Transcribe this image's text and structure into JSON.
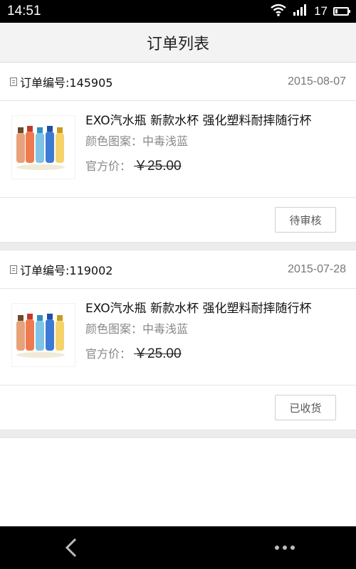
{
  "status_bar": {
    "time": "14:51",
    "battery_level": "17",
    "battery_fraction": 0.17,
    "icons": [
      "wifi-icon",
      "signal-icon",
      "battery-icon"
    ]
  },
  "header": {
    "title": "订单列表"
  },
  "orders": [
    {
      "order_label": "订单编号:145905",
      "date": "2015-08-07",
      "product_name": "EXO汽水瓶 新款水杯 强化塑料耐摔随行杯",
      "spec": "颜色图案：中毒浅蓝",
      "price_label": "官方价：",
      "price": "￥25.00",
      "status": "待审核"
    },
    {
      "order_label": "订单编号:119002",
      "date": "2015-07-28",
      "product_name": "EXO汽水瓶 新款水杯 强化塑料耐摔随行杯",
      "spec": "颜色图案：中毒浅蓝",
      "price_label": "官方价：",
      "price": "￥25.00",
      "status": "已收货"
    }
  ],
  "bottom_nav": {
    "icons": [
      "back-icon",
      "more-icon"
    ]
  },
  "colors": {
    "status_bar": "#000000",
    "header_bg": "#f3f3f3",
    "separator": "#ececec",
    "text_primary": "#111111",
    "text_secondary": "#888888"
  }
}
